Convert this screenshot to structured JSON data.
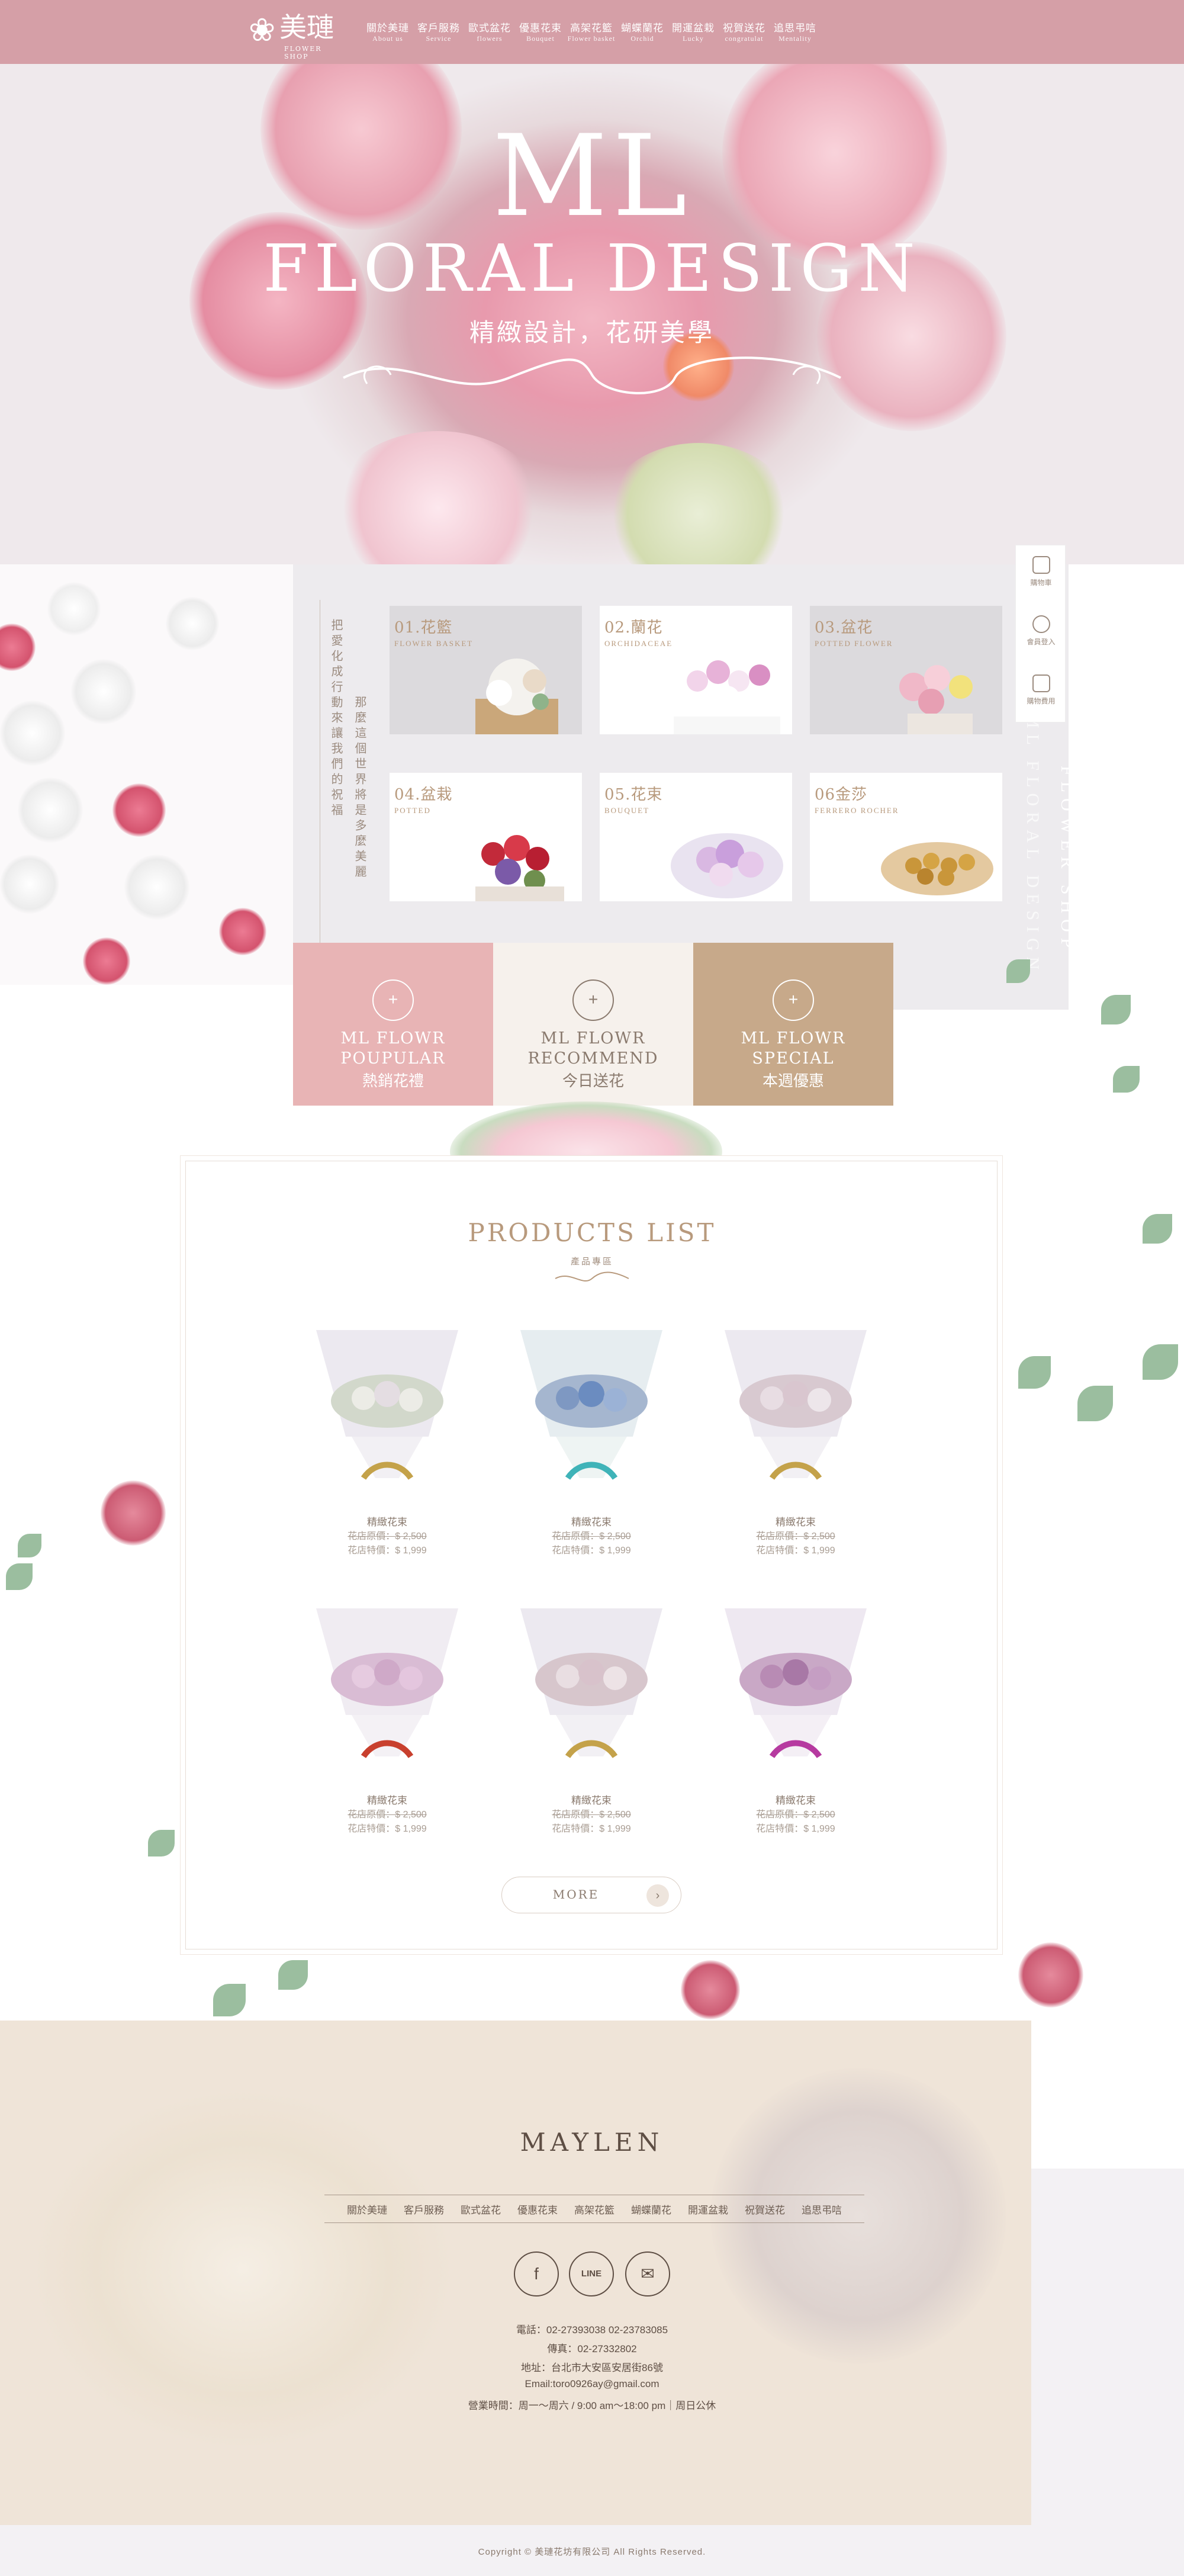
{
  "header": {
    "logo_text": "美璉",
    "logo_sub": "FLOWER SHOP",
    "nav": [
      {
        "zh": "關於美璉",
        "en": "About us"
      },
      {
        "zh": "客戶服務",
        "en": "Service"
      },
      {
        "zh": "歐式盆花",
        "en": "flowers"
      },
      {
        "zh": "優惠花束",
        "en": "Bouquet"
      },
      {
        "zh": "高架花籃",
        "en": "Flower basket"
      },
      {
        "zh": "蝴蝶蘭花",
        "en": "Orchid"
      },
      {
        "zh": "開運盆栽",
        "en": "Lucky"
      },
      {
        "zh": "祝賀送花",
        "en": "congratulat"
      },
      {
        "zh": "追思弔唁",
        "en": "Mentality"
      }
    ]
  },
  "hero": {
    "title_1": "ML",
    "title_2": "FLORAL DESIGN",
    "subtitle": "精緻設計，花研美學"
  },
  "intro": {
    "col1": "把愛化成行動來讓我們的祝福",
    "col2": "那麼這個世界將是多麼美麗"
  },
  "categories": [
    {
      "num": "01.花籃",
      "en": "FLOWER BASKET"
    },
    {
      "num": "02.蘭花",
      "en": "ORCHIDACEAE"
    },
    {
      "num": "03.盆花",
      "en": "POTTED FLOWER"
    },
    {
      "num": "04.盆栽",
      "en": "POTTED"
    },
    {
      "num": "05.花束",
      "en": "BOUQUET"
    },
    {
      "num": "06金莎",
      "en": "FERRERO ROCHER"
    }
  ],
  "side_bar": [
    {
      "label": "購物車",
      "icon": "cart-icon"
    },
    {
      "label": "會員登入",
      "icon": "line-icon"
    },
    {
      "label": "購物費用",
      "icon": "document-icon"
    }
  ],
  "side_vertical": [
    "FLOWER SHOP",
    "ML FLORAL DESIGN"
  ],
  "promos": [
    {
      "line1": "ML FLOWR",
      "line2": "POUPULAR",
      "zh": "熱銷花禮"
    },
    {
      "line1": "ML FLOWR",
      "line2": "RECOMMEND",
      "zh": "今日送花"
    },
    {
      "line1": "ML FLOWR",
      "line2": "SPECIAL",
      "zh": "本週優惠"
    }
  ],
  "products": {
    "title": "PRODUCTS LIST",
    "subtitle": "產品專區",
    "more": "MORE",
    "items": [
      {
        "name": "精緻花束",
        "orig": "花店原價：$ 2,500",
        "sale": "花店特價：$ 1,999",
        "ribbon": "#c4a24a",
        "bloom": "#cfd6c9"
      },
      {
        "name": "精緻花束",
        "orig": "花店原價：$ 2,500",
        "sale": "花店特價：$ 1,999",
        "ribbon": "#3fb3b8",
        "bloom": "#8fa8c8"
      },
      {
        "name": "精緻花束",
        "orig": "花店原價：$ 2,500",
        "sale": "花店特價：$ 1,999",
        "ribbon": "#c4a24a",
        "bloom": "#d8c9d0"
      },
      {
        "name": "精緻花束",
        "orig": "花店原價：$ 2,500",
        "sale": "花店特價：$ 1,999",
        "ribbon": "#c8402e",
        "bloom": "#d9bcd4"
      },
      {
        "name": "精緻花束",
        "orig": "花店原價：$ 2,500",
        "sale": "花店特價：$ 1,999",
        "ribbon": "#c4a24a",
        "bloom": "#d7c6cc"
      },
      {
        "name": "精緻花束",
        "orig": "花店原價：$ 2,500",
        "sale": "花店特價：$ 1,999",
        "ribbon": "#b63aa0",
        "bloom": "#c9a8c6"
      }
    ]
  },
  "footer": {
    "brand": "MAYLEN",
    "nav": [
      "關於美璉",
      "客戶服務",
      "歐式盆花",
      "優惠花束",
      "高架花籃",
      "蝴蝶蘭花",
      "開運盆栽",
      "祝賀送花",
      "追思弔唁"
    ],
    "social": [
      {
        "icon": "facebook-icon",
        "glyph": "f"
      },
      {
        "icon": "line-icon",
        "glyph": "LINE"
      },
      {
        "icon": "mail-icon",
        "glyph": "✉"
      }
    ],
    "info": [
      "電話：02-27393038 02-23783085",
      "傳真：02-27332802",
      "地址：台北市大安區安居街86號",
      "Email:toro0926ay@gmail.com",
      "營業時間：周一～周六 / 9:00 am～18:00 pm｜周日公休"
    ],
    "copyright": "Copyright © 美璉花坊有限公司 All Rights Reserved."
  },
  "colors": {
    "header": "#d59fa7",
    "accent": "#b89a7d",
    "promo_pink": "#e8b4b5",
    "promo_cream": "#f6f1ec",
    "promo_tan": "#c7a98a",
    "footer": "#efe4d8"
  }
}
